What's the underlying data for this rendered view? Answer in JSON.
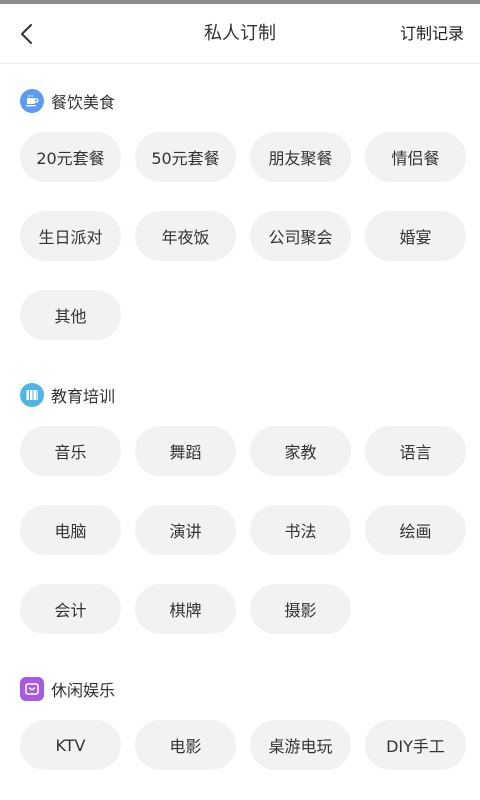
{
  "header": {
    "title": "私人订制",
    "records_label": "订制记录",
    "back_icon": "chevron-left-icon"
  },
  "sections": [
    {
      "id": "food",
      "title": "餐饮美食",
      "icon": "coffee-cup-icon",
      "icon_color": "#5b9bf2",
      "tags": [
        "20元套餐",
        "50元套餐",
        "朋友聚餐",
        "情侣餐",
        "生日派对",
        "年夜饭",
        "公司聚会",
        "婚宴",
        "其他"
      ]
    },
    {
      "id": "education",
      "title": "教育培训",
      "icon": "books-icon",
      "icon_color": "#4fb4e8",
      "tags": [
        "音乐",
        "舞蹈",
        "家教",
        "语言",
        "电脑",
        "演讲",
        "书法",
        "绘画",
        "会计",
        "棋牌",
        "摄影"
      ]
    },
    {
      "id": "leisure",
      "title": "休闲娱乐",
      "icon": "tv-icon",
      "icon_color": "#a55be0",
      "tags": [
        "KTV",
        "电影",
        "桌游电玩",
        "DIY手工"
      ]
    }
  ],
  "colors": {
    "tag_background": "#f2f2f2",
    "text": "#333333",
    "divider": "#ececec"
  }
}
